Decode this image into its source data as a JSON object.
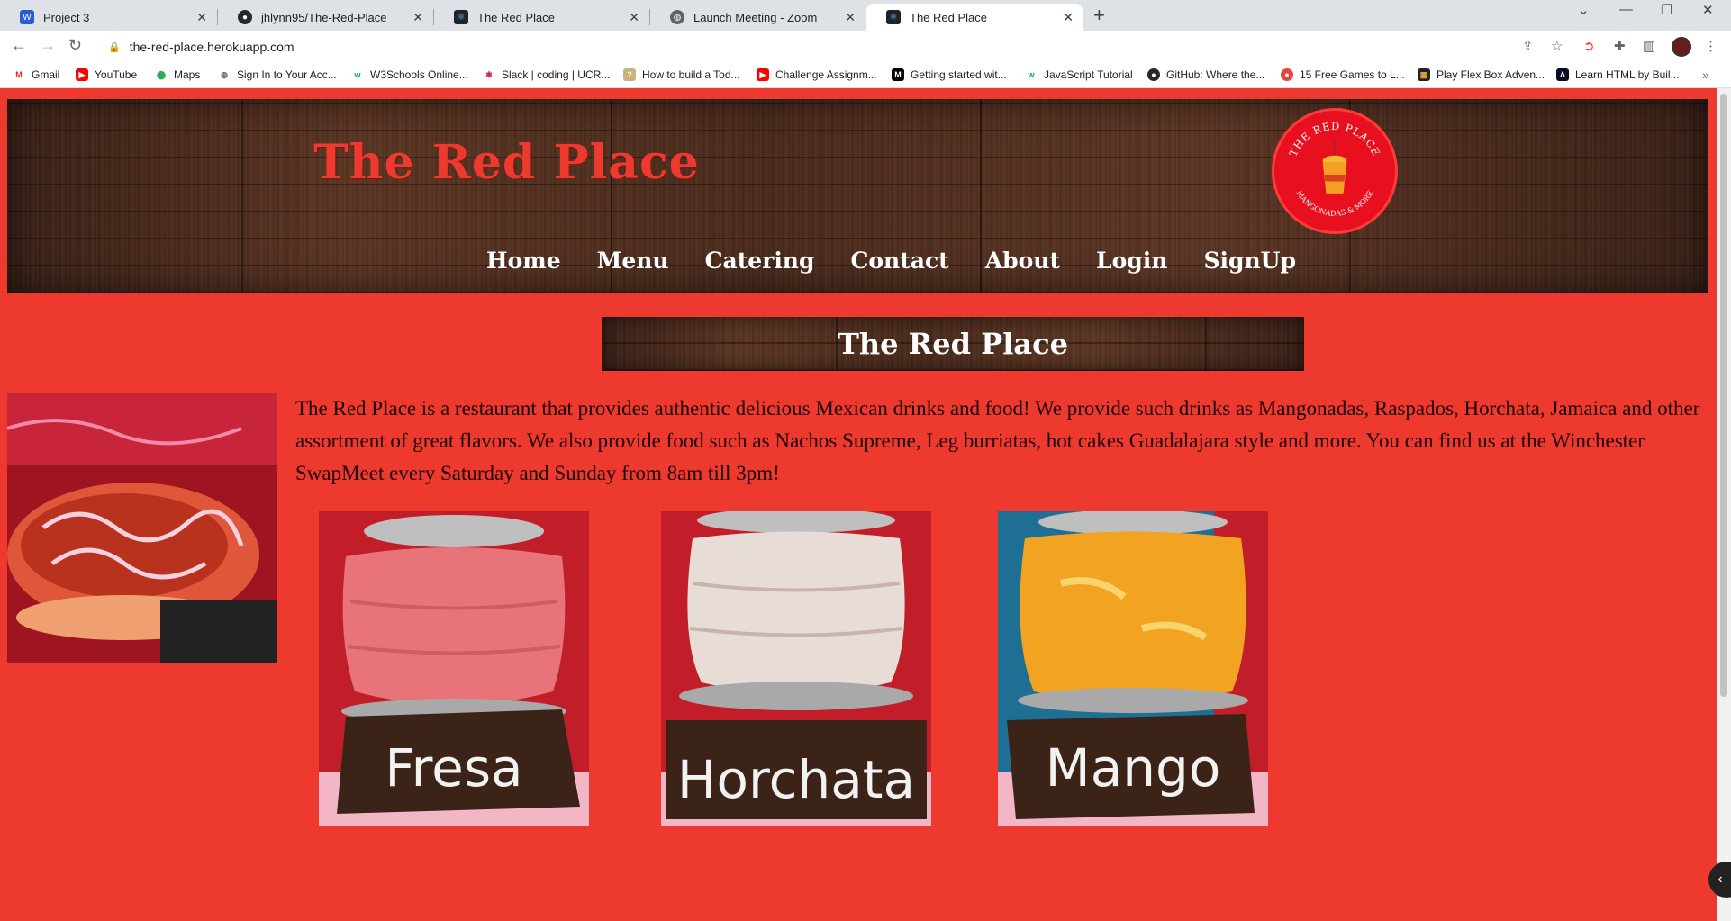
{
  "browser": {
    "tabs": [
      {
        "title": "Project 3",
        "active": false
      },
      {
        "title": "jhlynn95/The-Red-Place",
        "active": false
      },
      {
        "title": "The Red Place",
        "active": false
      },
      {
        "title": "Launch Meeting - Zoom",
        "active": false
      },
      {
        "title": "The Red Place",
        "active": true
      }
    ],
    "url": "the-red-place.herokuapp.com",
    "bookmarks": [
      "Gmail",
      "YouTube",
      "Maps",
      "Sign In to Your Acc...",
      "W3Schools Online...",
      "Slack | coding | UCR...",
      "How to build a Tod...",
      "Challenge Assignm...",
      "Getting started wit...",
      "JavaScript Tutorial",
      "GitHub: Where the...",
      "15 Free Games to L...",
      "Play Flex Box Adven...",
      "Learn HTML by Buil..."
    ]
  },
  "site": {
    "brand": "The Red Place",
    "logo_text_top": "THE RED PLACE",
    "logo_text_bottom": "MANGONADAS & MORE",
    "nav": [
      "Home",
      "Menu",
      "Catering",
      "Contact",
      "About",
      "Login",
      "SignUp"
    ],
    "heading": "The Red Place",
    "about": "The Red Place is a restaurant that provides authentic delicious Mexican drinks and food! We provide such drinks as Mangonadas, Raspados, Horchata, Jamaica and other assortment of great flavors. We also provide food such as Nachos Supreme, Leg burriatas, hot cakes Guadalajara style and more. You can find us at the Winchester SwapMeet every Saturday and Sunday from 8am till 3pm!",
    "drinks": [
      {
        "label": "Fresa",
        "color": "#e8747a"
      },
      {
        "label": "Horchata",
        "color": "#e8dcd6"
      },
      {
        "label": "Mango",
        "color": "#f2a321"
      }
    ]
  },
  "colors": {
    "page_bg": "#ee3a2e",
    "brand_red": "#ee3a2e"
  }
}
